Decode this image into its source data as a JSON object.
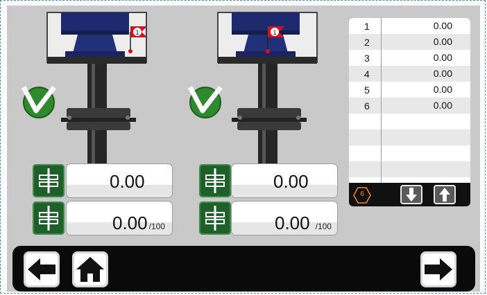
{
  "colors": {
    "panel": "#c9c9c9",
    "accent_green": "#1f5f2a",
    "check_green": "#2f8a2f",
    "flag_red": "#d0141c",
    "navbar": "#0a0a0a",
    "count_orange": "#f08a24"
  },
  "valves": [
    {
      "flag_number": "1",
      "status": "check-ok-icon",
      "reading": {
        "value": "0.00"
      },
      "percent": {
        "value": "0.00",
        "unit": "/100"
      }
    },
    {
      "flag_number": "1",
      "status": "check-ok-icon",
      "reading": {
        "value": "0.00"
      },
      "percent": {
        "value": "0.00",
        "unit": "/100"
      }
    }
  ],
  "table": {
    "rows": [
      {
        "index": "1",
        "value": "0.00"
      },
      {
        "index": "2",
        "value": "0.00"
      },
      {
        "index": "3",
        "value": "0.00"
      },
      {
        "index": "4",
        "value": "0.00"
      },
      {
        "index": "5",
        "value": "0.00"
      },
      {
        "index": "6",
        "value": "0.00"
      },
      {
        "index": "",
        "value": ""
      },
      {
        "index": "",
        "value": ""
      },
      {
        "index": "",
        "value": ""
      },
      {
        "index": "",
        "value": ""
      }
    ],
    "count": "6",
    "down_icon": "arrow-down-icon",
    "up_icon": "arrow-up-icon"
  },
  "nav": {
    "back_icon": "arrow-left-icon",
    "home_icon": "home-icon",
    "next_icon": "arrow-right-icon"
  }
}
